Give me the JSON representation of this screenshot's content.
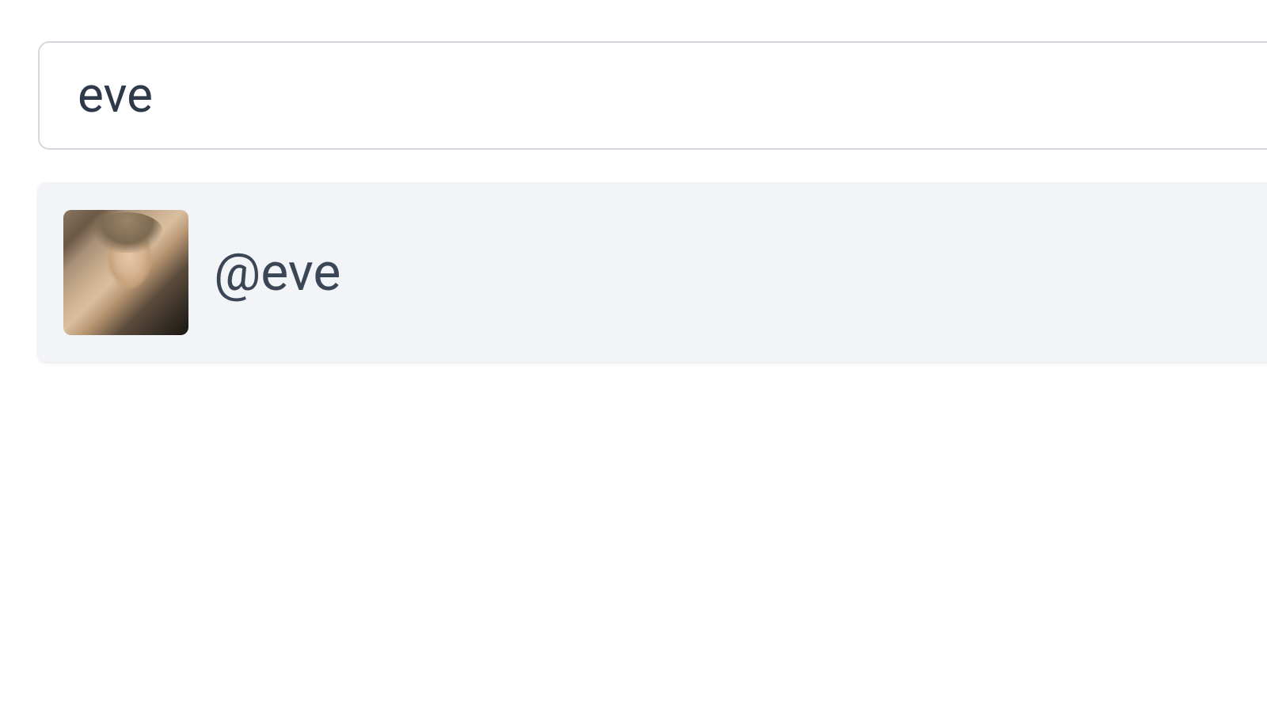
{
  "search": {
    "value": "eve"
  },
  "results": [
    {
      "handle": "@eve"
    }
  ]
}
